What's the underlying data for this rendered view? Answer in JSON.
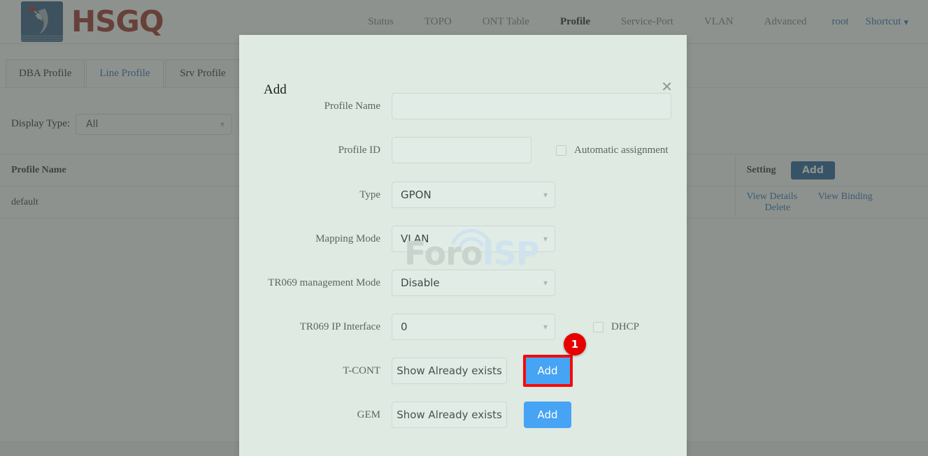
{
  "brand": {
    "name": "HSGQ",
    "logo_icon": "hsgq-logo-icon"
  },
  "topnav": {
    "items": [
      {
        "label": "Status",
        "active": false
      },
      {
        "label": "TOPO",
        "active": false
      },
      {
        "label": "ONT Table",
        "active": false
      },
      {
        "label": "Profile",
        "active": true
      },
      {
        "label": "Service-Port",
        "active": false
      },
      {
        "label": "VLAN",
        "active": false
      },
      {
        "label": "Advanced",
        "active": false
      }
    ],
    "user": "root",
    "shortcut": "Shortcut",
    "shortcut_caret_icon": "chevron-down-icon"
  },
  "tabs": [
    {
      "label": "DBA Profile",
      "active": false
    },
    {
      "label": "Line Profile",
      "active": true
    },
    {
      "label": "Srv Profile",
      "active": false
    }
  ],
  "filter": {
    "label": "Display Type:",
    "value": "All",
    "caret_icon": "chevron-down-icon"
  },
  "table": {
    "headers": {
      "profile_name": "Profile Name",
      "setting": "Setting"
    },
    "header_add_button": "Add",
    "rows": [
      {
        "profile_name": "default",
        "actions": [
          "View Details",
          "View Binding",
          "Delete"
        ]
      }
    ]
  },
  "modal": {
    "title": "Add",
    "close_icon": "close-icon",
    "fields": {
      "profile_name": {
        "label": "Profile Name",
        "value": "",
        "placeholder": ""
      },
      "profile_id": {
        "label": "Profile ID",
        "value": "",
        "placeholder": ""
      },
      "automatic_assignment": {
        "label": "Automatic assignment",
        "checked": false
      },
      "type": {
        "label": "Type",
        "value": "GPON",
        "caret_icon": "chevron-down-icon"
      },
      "mapping_mode": {
        "label": "Mapping Mode",
        "value": "VLAN",
        "caret_icon": "chevron-down-icon"
      },
      "tr069_management_mode": {
        "label": "TR069 management Mode",
        "value": "Disable",
        "caret_icon": "chevron-down-icon"
      },
      "tr069_ip_interface": {
        "label": "TR069 IP Interface",
        "value": "0",
        "caret_icon": "chevron-down-icon"
      },
      "dhcp": {
        "label": "DHCP",
        "checked": false
      },
      "tcont": {
        "label": "T-CONT",
        "show_button": "Show Already exists",
        "add_button": "Add"
      },
      "gem": {
        "label": "GEM",
        "show_button": "Show Already exists",
        "add_button": "Add"
      }
    }
  },
  "annotation": {
    "badge_number": "1"
  },
  "watermark": {
    "part1": "Foro",
    "part2": "ISP"
  },
  "colors": {
    "brand_red": "#9c2a21",
    "brand_blue": "#2d5480",
    "link_blue": "#2f6bb5",
    "primary_button": "#47a3f3",
    "table_add_button": "#1c5a99",
    "modal_bg": "#deeae2",
    "highlight_red": "#f40b0b",
    "badge_red": "#e60000"
  }
}
